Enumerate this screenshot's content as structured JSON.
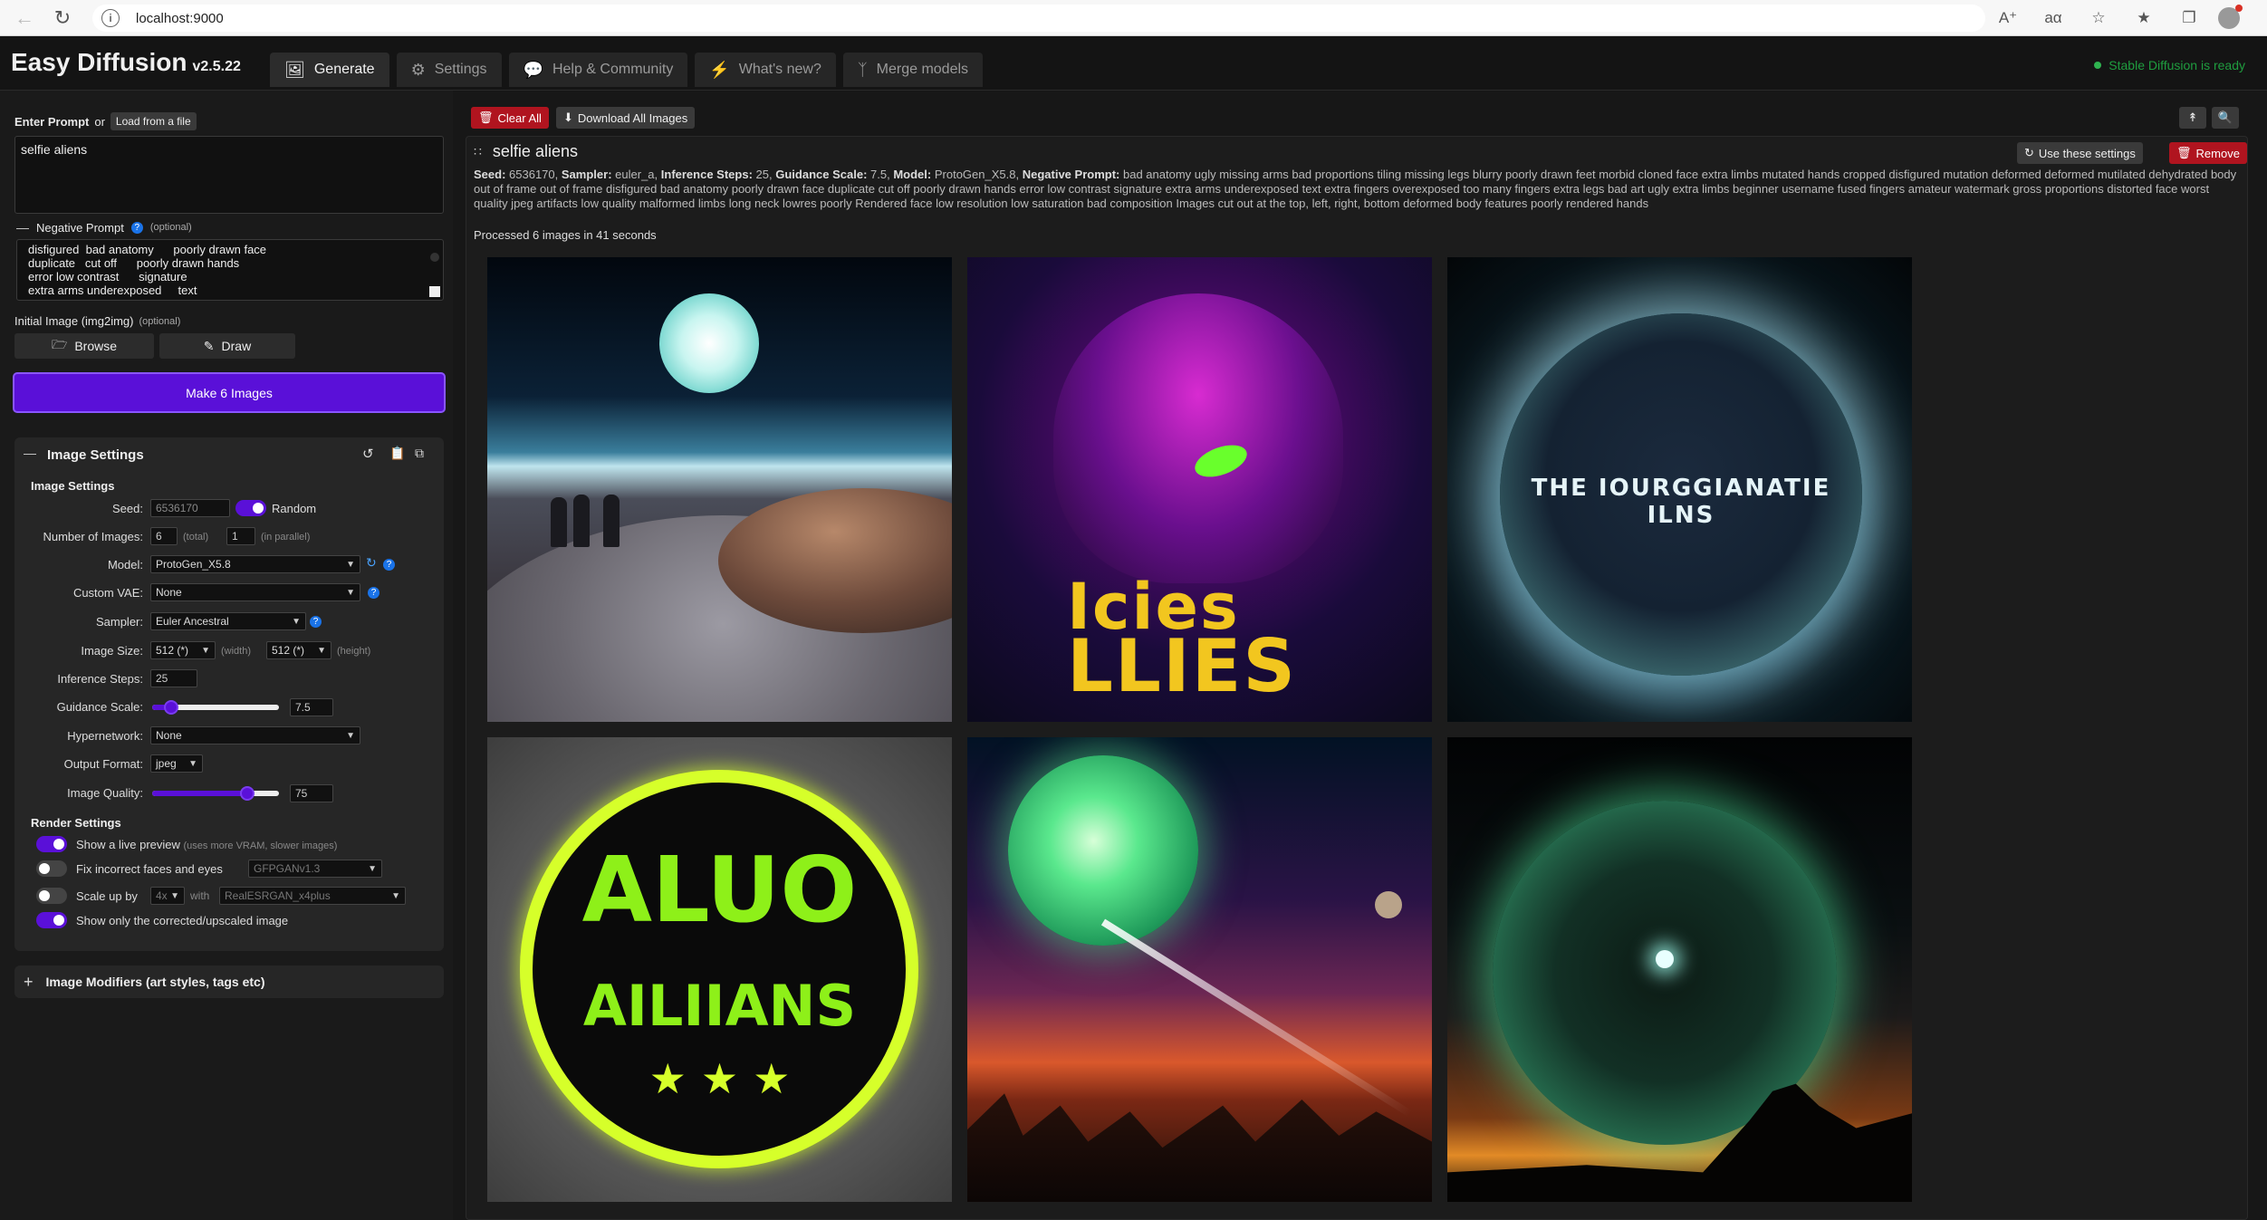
{
  "browser": {
    "url": "localhost:9000"
  },
  "app": {
    "title": "Easy Diffusion",
    "version": "v2.5.22",
    "status": "Stable Diffusion is ready",
    "tabs": [
      {
        "label": "Generate",
        "icon": "image-icon"
      },
      {
        "label": "Settings",
        "icon": "gear-icon"
      },
      {
        "label": "Help & Community",
        "icon": "comments-icon"
      },
      {
        "label": "What's new?",
        "icon": "bolt-icon"
      },
      {
        "label": "Merge models",
        "icon": "merge-icon"
      }
    ]
  },
  "prompt": {
    "enter_label": "Enter Prompt",
    "or_label": "or",
    "load_file": "Load from a file",
    "value": "selfie aliens",
    "negative_label": "Negative Prompt",
    "optional": "(optional)",
    "negative_lines": [
      "disfigured  bad anatomy      poorly drawn face",
      "duplicate   cut off      poorly drawn hands",
      "error low contrast      signature",
      "extra arms underexposed     text"
    ],
    "initial_image_label": "Initial Image (img2img)",
    "browse": "Browse",
    "draw": "Draw",
    "make_button": "Make 6 Images"
  },
  "image_settings": {
    "panel_title": "Image Settings",
    "section_title": "Image Settings",
    "seed_label": "Seed:",
    "seed_value": "6536170",
    "random_label": "Random",
    "num_images_label": "Number of Images:",
    "num_images_value": "6",
    "total_label": "(total)",
    "parallel_value": "1",
    "parallel_label": "(in parallel)",
    "model_label": "Model:",
    "model_value": "ProtoGen_X5.8",
    "vae_label": "Custom VAE:",
    "vae_value": "None",
    "sampler_label": "Sampler:",
    "sampler_value": "Euler Ancestral",
    "size_label": "Image Size:",
    "width_value": "512 (*)",
    "width_label": "(width)",
    "height_value": "512 (*)",
    "height_label": "(height)",
    "steps_label": "Inference Steps:",
    "steps_value": "25",
    "guidance_label": "Guidance Scale:",
    "guidance_value": "7.5",
    "guidance_fraction": 0.15,
    "hypernetwork_label": "Hypernetwork:",
    "hypernetwork_value": "None",
    "format_label": "Output Format:",
    "format_value": "jpeg",
    "quality_label": "Image Quality:",
    "quality_value": "75",
    "quality_fraction": 0.75
  },
  "render_settings": {
    "title": "Render Settings",
    "live_preview": "Show a live preview",
    "live_preview_note": "(uses more VRAM, slower images)",
    "fix_faces": "Fix incorrect faces and eyes",
    "fix_faces_model": "GFPGANv1.3",
    "scale_up": "Scale up by",
    "scale_value": "4x",
    "with_label": "with",
    "upscaler": "RealESRGAN_x4plus",
    "only_corrected": "Show only the corrected/upscaled image"
  },
  "modifiers": {
    "title": "Image Modifiers (art styles, tags etc)"
  },
  "toolbar": {
    "clear_all": "Clear All",
    "download_all": "Download All Images"
  },
  "task": {
    "title": "selfie aliens",
    "use_settings": "Use these settings",
    "remove": "Remove",
    "seed_label": "Seed:",
    "seed_value": "6536170,",
    "sampler_label": "Sampler:",
    "sampler_value": "euler_a,",
    "steps_label": "Inference Steps:",
    "steps_value": "25,",
    "guidance_label": "Guidance Scale:",
    "guidance_value": "7.5,",
    "model_label": "Model:",
    "model_value": "ProtoGen_X5.8,",
    "negative_label": "Negative Prompt:",
    "negative_value": "bad anatomy ugly missing arms bad proportions tiling missing legs blurry poorly drawn feet morbid cloned face extra limbs mutated hands cropped disfigured mutation deformed deformed mutilated dehydrated body out of frame out of frame disfigured bad anatomy poorly drawn face duplicate cut off poorly drawn hands error low contrast signature extra arms underexposed text extra fingers overexposed too many fingers extra legs bad art ugly extra limbs beginner username fused fingers amateur watermark gross proportions distorted face worst quality jpeg artifacts low quality malformed limbs long neck lowres poorly Rendered face low resolution low saturation bad composition Images cut out at the top, left, right, bottom deformed body features poorly rendered hands",
    "processed_prefix": "Processed",
    "processed_count": "6",
    "processed_mid": "images in",
    "processed_seconds": "41",
    "processed_suffix": "seconds"
  },
  "images": {
    "img2_text": "LLIES",
    "img2_text_top": "Icies",
    "img3_text": "THE IOURGGIANATIE ILNS",
    "img4_text_top": "ALUO",
    "img4_text_bottom": "AILIIANS",
    "img4_stars": "★ ★ ★"
  },
  "colors": {
    "accent": "#5a10d8",
    "danger": "#b0141f",
    "status": "#2fb350"
  }
}
